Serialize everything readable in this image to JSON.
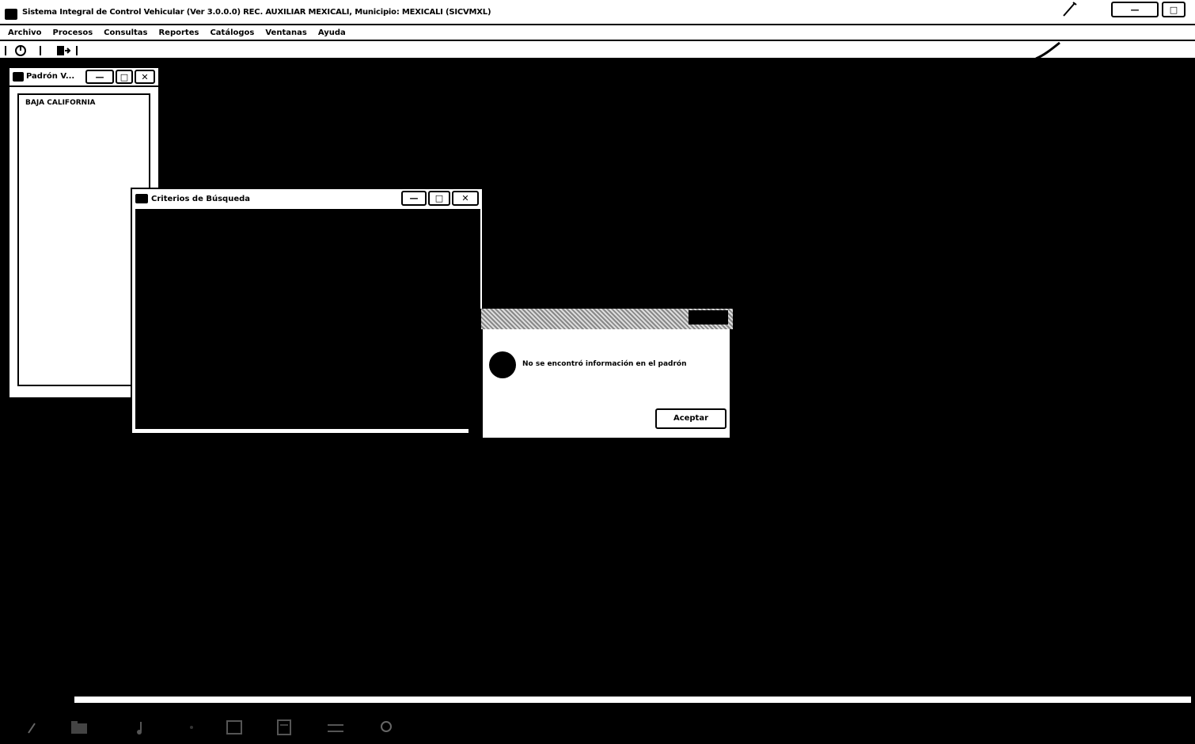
{
  "window": {
    "title": "Sistema Integral de Control Vehicular (Ver 3.0.0.0) REC. AUXILIAR MEXICALI, Municipio: MEXICALI (SICVMXL)",
    "buttons": {
      "minimize": "—",
      "maximize": "□",
      "close": "✕"
    }
  },
  "menu": {
    "items": [
      "Archivo",
      "Procesos",
      "Consultas",
      "Reportes",
      "Catálogos",
      "Ventanas",
      "Ayuda"
    ]
  },
  "toolbar": {
    "icons": [
      "power-icon",
      "exit-icon"
    ]
  },
  "padron_window": {
    "title": "Padrón V...",
    "list_items": [
      "BAJA CALIFORNIA"
    ]
  },
  "criterios_window": {
    "title": "Criterios de Búsqueda"
  },
  "message_box": {
    "message": "No se encontró información en el padrón",
    "ok_label": "Aceptar"
  },
  "taskbar": {
    "icons": [
      "start-icon",
      "file-manager-icon",
      "music-icon",
      "settings-icon",
      "window-icon",
      "documents-icon",
      "terminal-icon",
      "search-icon"
    ]
  }
}
